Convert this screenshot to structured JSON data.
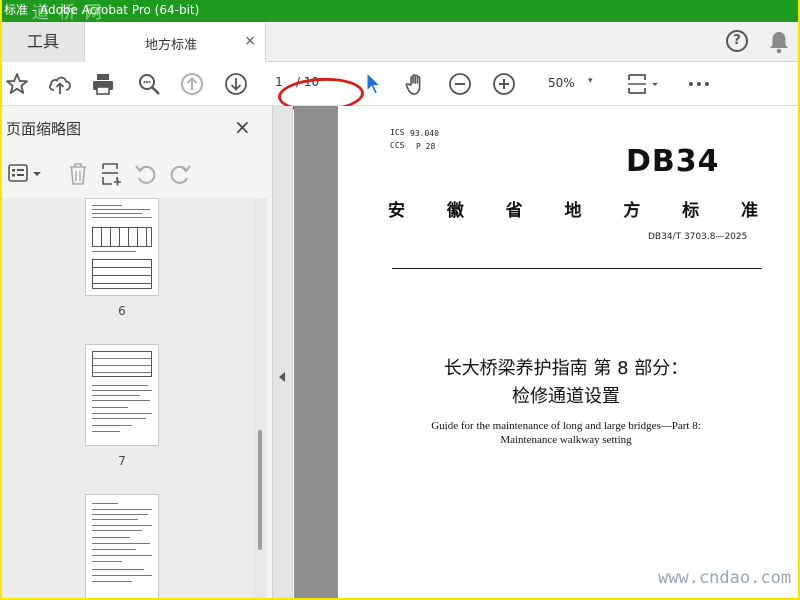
{
  "window": {
    "title": "标准 - Adobe Acrobat Pro (64-bit)",
    "watermark_top": "道 桥 网"
  },
  "tabs": {
    "tools": "工具",
    "document": "地方标准",
    "close": "×"
  },
  "header": {
    "help": "?"
  },
  "toolbar": {
    "page_current": "1",
    "page_total": "/ 10",
    "zoom": "50%",
    "zoom_caret": "▾"
  },
  "side_panel": {
    "title": "页面缩略图",
    "close": "×",
    "thumbnails": [
      {
        "label": "6"
      },
      {
        "label": "7"
      },
      {
        "label": ""
      }
    ]
  },
  "document": {
    "ics_label": "ICS",
    "ics_value": "93.040",
    "ccs_label": "CCS",
    "ccs_value": "P 28",
    "logo": "DB34",
    "std_title_chars": [
      "安",
      "徽",
      "省",
      "地",
      "方",
      "标",
      "准"
    ],
    "std_number": "DB34/T 3703.8—2025",
    "title_cn_line1": "长大桥梁养护指南 第 8 部分：",
    "title_cn_line2": "检修通道设置",
    "title_en_line1": "Guide for the maintenance of long and large bridges—Part 8:",
    "title_en_line2": "Maintenance walkway setting"
  },
  "watermark_bottom": "www.cndao.com",
  "colors": {
    "titlebar": "#1e9a1e",
    "border": "#f7e600",
    "annotation": "#d6201c",
    "cursor": "#1f6fd6"
  }
}
